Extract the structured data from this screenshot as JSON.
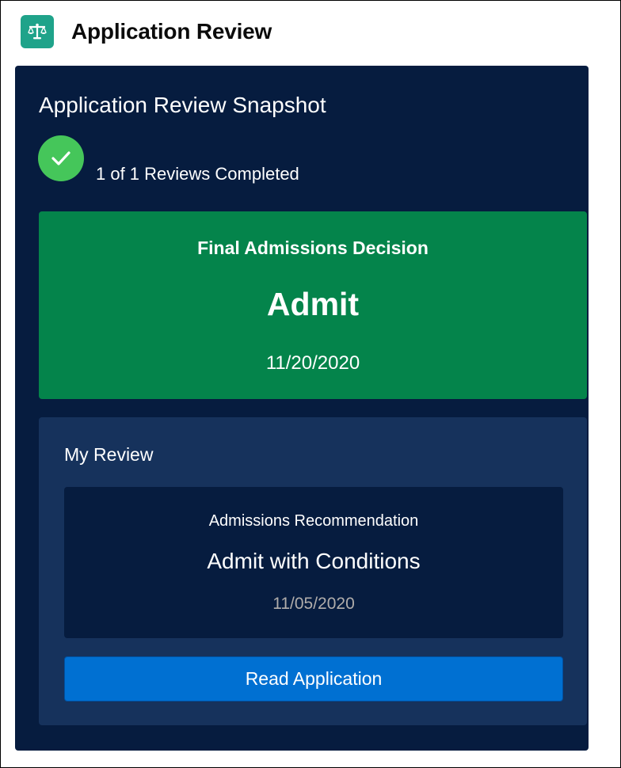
{
  "header": {
    "icon": "scales-icon",
    "title": "Application Review"
  },
  "snapshot": {
    "title": "Application Review Snapshot",
    "status_icon": "check-icon",
    "reviews_completed": "1 of 1 Reviews Completed"
  },
  "final_decision": {
    "label": "Final Admissions Decision",
    "value": "Admit",
    "date": "11/20/2020"
  },
  "my_review": {
    "title": "My Review",
    "recommendation_label": "Admissions Recommendation",
    "recommendation_value": "Admit with Conditions",
    "recommendation_date": "11/05/2020",
    "button_label": "Read Application"
  },
  "colors": {
    "app_icon": "#1fa38a",
    "panel_background": "#061c3f",
    "decision_card": "#04844b",
    "my_review_background": "#16325c",
    "check_circle": "#45c65a",
    "button": "#0070d2"
  }
}
